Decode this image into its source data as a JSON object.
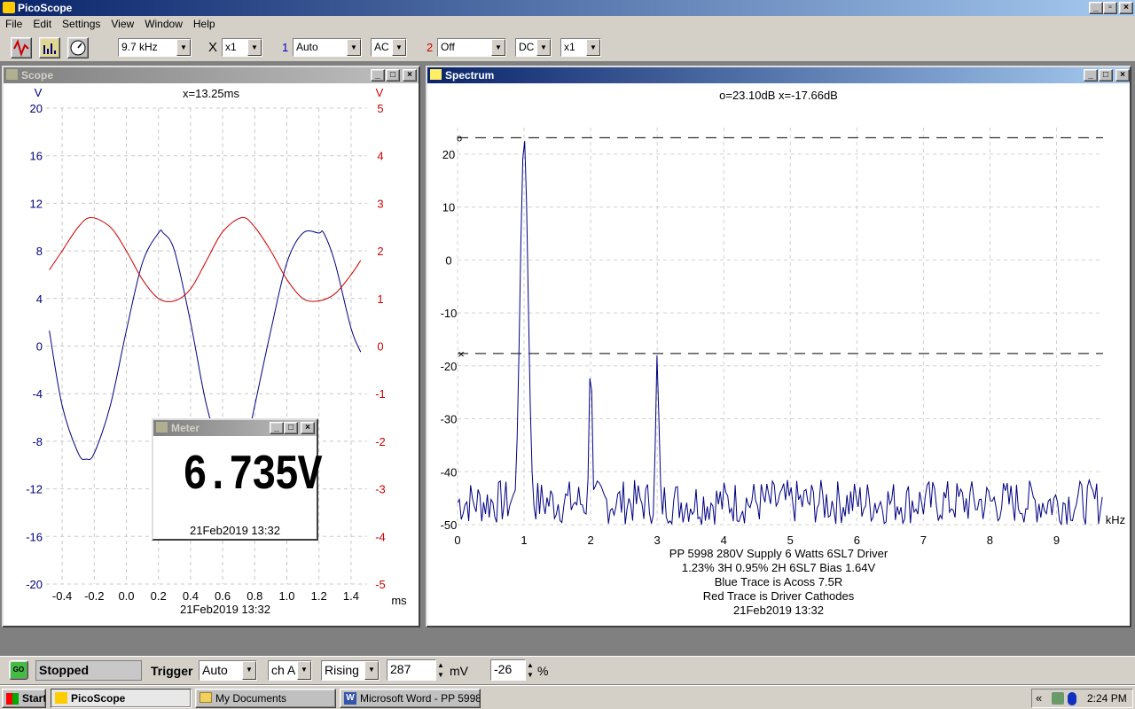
{
  "app": {
    "title": "PicoScope"
  },
  "menu": [
    "File",
    "Edit",
    "Settings",
    "View",
    "Window",
    "Help"
  ],
  "toolbar": {
    "timebase": "9.7 kHz",
    "x_mult_label": "X",
    "x_mult": "x1",
    "ch1_num": "1",
    "ch1_range": "Auto",
    "ch1_coupling": "AC",
    "ch2_num": "2",
    "ch2_range": "Off",
    "ch2_coupling": "DC",
    "ch2_mult": "x1"
  },
  "scope": {
    "title": "Scope",
    "cursor_readout": "x=13.25ms",
    "left_unit": "V",
    "right_unit": "V",
    "left_ticks": [
      "20",
      "16",
      "12",
      "8",
      "4",
      "0",
      "-4",
      "-8",
      "-12",
      "-16",
      "-20"
    ],
    "right_ticks": [
      "5",
      "4",
      "3",
      "2",
      "1",
      "0",
      "-1",
      "-2",
      "-3",
      "-4",
      "-5"
    ],
    "x_ticks": [
      "-0.4",
      "-0.2",
      "0.0",
      "0.2",
      "0.4",
      "0.6",
      "0.8",
      "1.0",
      "1.2",
      "1.4"
    ],
    "x_unit": "ms",
    "timestamp": "21Feb2019  13:32"
  },
  "meter": {
    "title": "Meter",
    "value": "6.735V",
    "timestamp": "21Feb2019  13:32"
  },
  "spectrum": {
    "title": "Spectrum",
    "cursor_readout": "o=23.10dB  x=-17.66dB",
    "cursor_o_marker": "o",
    "cursor_x_marker": "×",
    "y_ticks": [
      "20",
      "10",
      "0",
      "-10",
      "-20",
      "-30",
      "-40",
      "-50"
    ],
    "x_ticks": [
      "0",
      "1",
      "2",
      "3",
      "4",
      "5",
      "6",
      "7",
      "8",
      "9"
    ],
    "x_unit": "kHz",
    "notes": [
      "PP 5998 280V Supply 6 Watts 6SL7 Driver",
      "1.23% 3H 0.95% 2H 6SL7 Bias 1.64V",
      "Blue Trace is Acoss 7.5R",
      "Red Trace is Driver Cathodes",
      "21Feb2019  13:32"
    ]
  },
  "status": {
    "go_label": "GO",
    "state": "Stopped",
    "trigger_label": "Trigger",
    "trigger_mode": "Auto",
    "trigger_channel": "ch A",
    "trigger_edge": "Rising",
    "trigger_level": "287",
    "trigger_level_unit": "mV",
    "trigger_delay": "-26",
    "trigger_delay_unit": "%"
  },
  "taskbar": {
    "start": "Start",
    "tasks": [
      "PicoScope",
      "My Documents",
      "Microsoft Word - PP 5998..."
    ],
    "tray_chevron": "«",
    "clock": "2:24 PM"
  },
  "colors": {
    "blue_trace": "#000080",
    "red_trace": "#cc0000",
    "axis_blue": "#000080",
    "axis_red": "#cc0000"
  },
  "chart_data": [
    {
      "type": "line",
      "title": "Scope",
      "xlabel": "ms",
      "xlim": [
        -0.5,
        1.5
      ],
      "ylim_left": [
        -20,
        20
      ],
      "ylim_right": [
        -5,
        5
      ],
      "series": [
        {
          "axis": "left",
          "color": "#000080",
          "x": [
            -0.48,
            -0.4,
            -0.3,
            -0.25,
            -0.2,
            -0.1,
            0.0,
            0.1,
            0.2,
            0.23,
            0.3,
            0.4,
            0.5,
            0.6,
            0.7,
            0.75,
            0.8,
            0.9,
            1.0,
            1.1,
            1.2,
            1.23,
            1.3,
            1.4,
            1.46
          ],
          "y": [
            1.3,
            -5.0,
            -9.0,
            -9.5,
            -9.0,
            -5.0,
            1.3,
            7.0,
            9.5,
            9.5,
            8.0,
            2.0,
            -5.0,
            -9.0,
            -9.0,
            -8.0,
            -5.0,
            1.3,
            7.0,
            9.5,
            9.5,
            9.5,
            7.0,
            1.5,
            -0.5
          ]
        },
        {
          "axis": "right",
          "color": "#cc0000",
          "x": [
            -0.48,
            -0.4,
            -0.3,
            -0.22,
            -0.1,
            0.0,
            0.1,
            0.2,
            0.3,
            0.4,
            0.5,
            0.6,
            0.72,
            0.8,
            0.9,
            1.0,
            1.1,
            1.2,
            1.3,
            1.4,
            1.46
          ],
          "y": [
            1.6,
            2.0,
            2.5,
            2.7,
            2.5,
            2.0,
            1.4,
            1.0,
            0.95,
            1.2,
            1.8,
            2.4,
            2.7,
            2.5,
            2.0,
            1.4,
            1.0,
            0.95,
            1.1,
            1.5,
            1.8
          ]
        }
      ]
    },
    {
      "type": "line",
      "title": "Spectrum",
      "xlabel": "kHz",
      "xlim": [
        0,
        9.7
      ],
      "ylim": [
        -50,
        25
      ],
      "cursors_db": [
        23.1,
        -17.66
      ],
      "series": [
        {
          "color": "#000080",
          "peaks": [
            {
              "x": 1.0,
              "y": 23.1
            },
            {
              "x": 2.0,
              "y": -19.0
            },
            {
              "x": 3.0,
              "y": -17.66
            }
          ],
          "noise_floor": [
            -50,
            -40
          ]
        }
      ]
    }
  ]
}
